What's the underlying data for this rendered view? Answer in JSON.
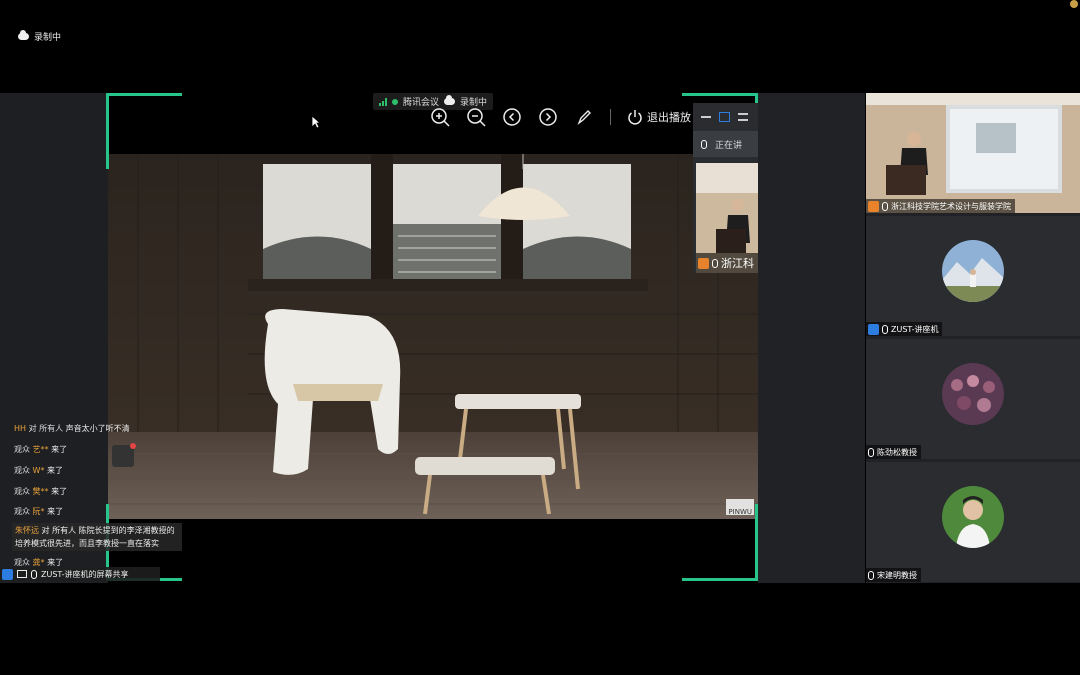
{
  "top": {
    "recording_label": "录制中"
  },
  "meeting_bar": {
    "app_name": "腾讯会议",
    "recording_label": "录制中"
  },
  "toolbar": {
    "zoom_in_icon": "zoom-in-icon",
    "zoom_out_icon": "zoom-out-icon",
    "prev_icon": "chevron-left-icon",
    "next_icon": "chevron-right-icon",
    "pen_icon": "pen-icon",
    "exit_label": "退出播放"
  },
  "mini_panel": {
    "speaking_label": "正在讲",
    "speaker_name": "浙江科"
  },
  "chat": {
    "messages": [
      {
        "user": "HH",
        "to": "对 所有人",
        "text": "声音太小了听不清"
      },
      {
        "prefix": "观众",
        "user": "艺**",
        "text": "来了"
      },
      {
        "prefix": "观众",
        "user": "W*",
        "text": "来了"
      },
      {
        "prefix": "观众",
        "user": "樊**",
        "text": "来了"
      },
      {
        "prefix": "观众",
        "user": "阮*",
        "text": "来了"
      },
      {
        "user": "朱怀远",
        "to": "对 所有人",
        "text": "陈院长提到的李泽湘教授的培养模式很先进，而且李教授一直在落实"
      },
      {
        "prefix": "观众",
        "user": "龚*",
        "text": "来了"
      }
    ]
  },
  "status": {
    "share_label": "ZUST-讲座机的屏幕共享"
  },
  "participants": [
    {
      "name": "浙江科技学院艺术设计与服装学院"
    },
    {
      "name": "ZUST-讲座机"
    },
    {
      "name": "陈劲松教授"
    },
    {
      "name": "宋建明教授"
    }
  ],
  "watermark": "PINWU",
  "colors": {
    "accent_green": "#27c48b",
    "chat_user": "#e8a13b",
    "brand_blue": "#2d7de0"
  }
}
